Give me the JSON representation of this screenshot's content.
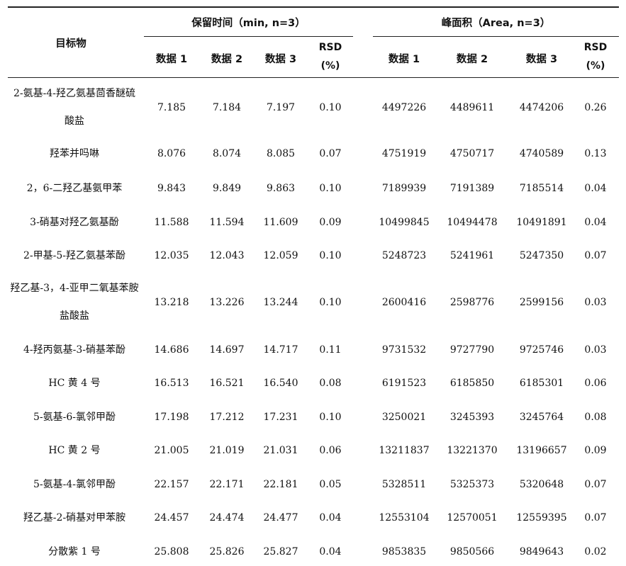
{
  "headers": {
    "target": "目标物",
    "retention_group": "保留时间（min, n=3）",
    "area_group": "峰面积（Area, n=3）",
    "data1": "数据 1",
    "data2": "数据 2",
    "data3": "数据 3",
    "rsd_line1": "RSD",
    "rsd_line2": "(%)"
  },
  "rows": [
    {
      "name": "2-氨基-4-羟乙氨基茴香醚硫酸盐",
      "rt": [
        "7.185",
        "7.184",
        "7.197"
      ],
      "rt_rsd": "0.10",
      "area": [
        "4497226",
        "4489611",
        "4474206"
      ],
      "area_rsd": "0.26"
    },
    {
      "name": "羟苯并吗啉",
      "rt": [
        "8.076",
        "8.074",
        "8.085"
      ],
      "rt_rsd": "0.07",
      "area": [
        "4751919",
        "4750717",
        "4740589"
      ],
      "area_rsd": "0.13"
    },
    {
      "name": "2，6-二羟乙基氨甲苯",
      "rt": [
        "9.843",
        "9.849",
        "9.863"
      ],
      "rt_rsd": "0.10",
      "area": [
        "7189939",
        "7191389",
        "7185514"
      ],
      "area_rsd": "0.04"
    },
    {
      "name": "3-硝基对羟乙氨基酚",
      "rt": [
        "11.588",
        "11.594",
        "11.609"
      ],
      "rt_rsd": "0.09",
      "area": [
        "10499845",
        "10494478",
        "10491891"
      ],
      "area_rsd": "0.04"
    },
    {
      "name": "2-甲基-5-羟乙氨基苯酚",
      "rt": [
        "12.035",
        "12.043",
        "12.059"
      ],
      "rt_rsd": "0.10",
      "area": [
        "5248723",
        "5241961",
        "5247350"
      ],
      "area_rsd": "0.07"
    },
    {
      "name": "羟乙基-3，4-亚甲二氧基苯胺盐酸盐",
      "rt": [
        "13.218",
        "13.226",
        "13.244"
      ],
      "rt_rsd": "0.10",
      "area": [
        "2600416",
        "2598776",
        "2599156"
      ],
      "area_rsd": "0.03"
    },
    {
      "name": "4-羟丙氨基-3-硝基苯酚",
      "rt": [
        "14.686",
        "14.697",
        "14.717"
      ],
      "rt_rsd": "0.11",
      "area": [
        "9731532",
        "9727790",
        "9725746"
      ],
      "area_rsd": "0.03"
    },
    {
      "name": "HC 黄 4 号",
      "rt": [
        "16.513",
        "16.521",
        "16.540"
      ],
      "rt_rsd": "0.08",
      "area": [
        "6191523",
        "6185850",
        "6185301"
      ],
      "area_rsd": "0.06"
    },
    {
      "name": "5-氨基-6-氯邻甲酚",
      "rt": [
        "17.198",
        "17.212",
        "17.231"
      ],
      "rt_rsd": "0.10",
      "area": [
        "3250021",
        "3245393",
        "3245764"
      ],
      "area_rsd": "0.08"
    },
    {
      "name": "HC 黄 2 号",
      "rt": [
        "21.005",
        "21.019",
        "21.031"
      ],
      "rt_rsd": "0.06",
      "area": [
        "13211837",
        "13221370",
        "13196657"
      ],
      "area_rsd": "0.09"
    },
    {
      "name": "5-氨基-4-氯邻甲酚",
      "rt": [
        "22.157",
        "22.171",
        "22.181"
      ],
      "rt_rsd": "0.05",
      "area": [
        "5328511",
        "5325373",
        "5320648"
      ],
      "area_rsd": "0.07"
    },
    {
      "name": "羟乙基-2-硝基对甲苯胺",
      "rt": [
        "24.457",
        "24.474",
        "24.477"
      ],
      "rt_rsd": "0.04",
      "area": [
        "12553104",
        "12570051",
        "12559395"
      ],
      "area_rsd": "0.07"
    },
    {
      "name": "分散紫 1 号",
      "rt": [
        "25.808",
        "25.826",
        "25.827"
      ],
      "rt_rsd": "0.04",
      "area": [
        "9853835",
        "9850566",
        "9849643"
      ],
      "area_rsd": "0.02"
    }
  ]
}
